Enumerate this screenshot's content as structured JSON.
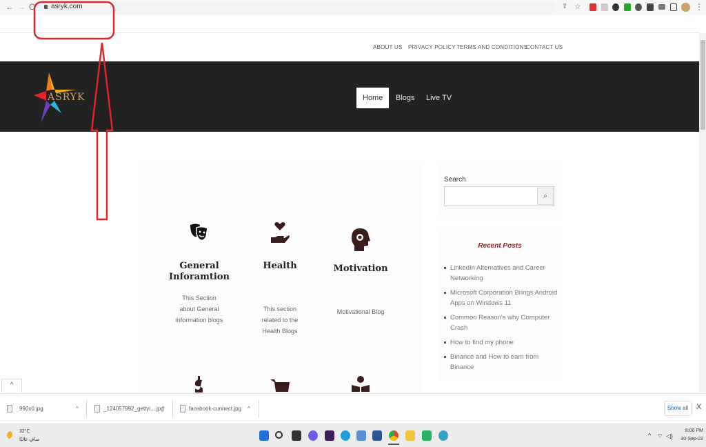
{
  "browser": {
    "url": "asryk.com",
    "nav_back": "←",
    "nav_forward": "→",
    "nav_reload": "C",
    "share_icon": "⇪",
    "star_icon": "☆",
    "menu_icon": "⋮"
  },
  "top_links": [
    "ABOUT US",
    "PRIVACY POLICY",
    "TERMS AND CONDITIONS",
    "CONTACT US"
  ],
  "logo": {
    "text": "ASRYK"
  },
  "main_nav": {
    "items": [
      {
        "label": "Home",
        "active": true
      },
      {
        "label": "Blogs",
        "active": false
      },
      {
        "label": "Live TV",
        "active": false
      }
    ]
  },
  "categories": [
    {
      "icon": "theater-masks-icon",
      "title": "General Inforamtion",
      "description": "This Section about General information blogs"
    },
    {
      "icon": "hand-holding-heart-icon",
      "title": "Health",
      "description": "This section related to the Health Blogs"
    },
    {
      "icon": "head-gear-icon",
      "title": "Motivation",
      "description": "Motivational Blog"
    }
  ],
  "categories_row2_icons": [
    "dollar-icon",
    "cart-icon",
    "reader-icon"
  ],
  "sidebar": {
    "search_label": "Search",
    "search_value": "",
    "search_button_icon": "⌕",
    "recent_posts_title": "Recent Posts",
    "recent_posts": [
      "LinkedIn Alternatives and Career Networking",
      "Microsoft Corporation Brings Android Apps on Windows 11",
      "Common Reason's why Computer Crash",
      "How to find my phone",
      "Binance and How to earn from Binance"
    ]
  },
  "downloads": {
    "files": [
      "960x0.jpg",
      "_124057992_gettyi....jpg",
      "facebook-connect.jpg"
    ],
    "show_all": "Show all",
    "close": "X",
    "scroll_top": "^"
  },
  "taskbar": {
    "weather_temp": "32°C",
    "weather_desc": "صافٍ غالبًا",
    "time": "8:00 PM",
    "date": "30-Sep-22",
    "tray_chevron": "^"
  },
  "colors": {
    "header_bg": "#222222",
    "accent_red": "#8b2a2a",
    "annotation_red": "#e0252b",
    "icon_brown": "#3a1c1c"
  }
}
